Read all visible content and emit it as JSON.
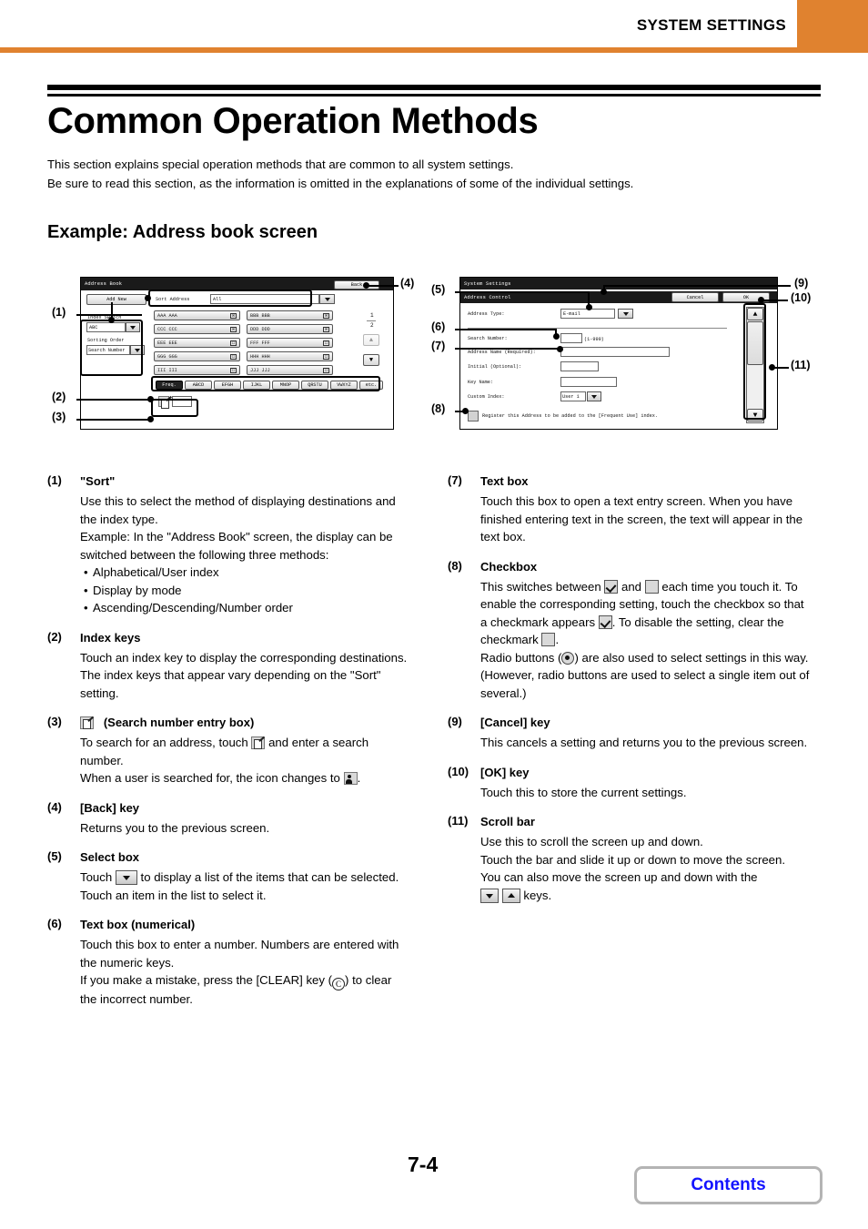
{
  "header": {
    "title": "SYSTEM SETTINGS",
    "accent_color": "#E0822F"
  },
  "chapter": {
    "title": "Common Operation Methods",
    "intro_line1": "This section explains special operation methods that are common to all system settings.",
    "intro_line2": "Be sure to read this section, as the information is omitted in the explanations of some of the individual settings.",
    "section_title": "Example: Address book screen"
  },
  "figure_left": {
    "titlebar": "Address Book",
    "back_key": "Back",
    "add_new_key": "Add New",
    "sort_address_label": "Sort Address",
    "sort_address_value": "All",
    "index_switch_label": "Index Switch",
    "index_switch_value": "ABC",
    "sorting_order_label": "Sorting Order",
    "sorting_order_value": "Search Number",
    "addresses": [
      {
        "name": "AAA AAA",
        "icon": "mail-icon"
      },
      {
        "name": "BBB BBB",
        "icon": "mail-icon"
      },
      {
        "name": "CCC CCC",
        "icon": "mail-icon"
      },
      {
        "name": "DDD DDD",
        "icon": "mail-icon"
      },
      {
        "name": "EEE EEE",
        "icon": "fax-icon"
      },
      {
        "name": "FFF FFF",
        "icon": "fax-icon"
      },
      {
        "name": "GGG GGG",
        "icon": "fax-icon"
      },
      {
        "name": "HHH HHH",
        "icon": "fax-icon"
      },
      {
        "name": "III III",
        "icon": "fax-icon"
      },
      {
        "name": "JJJ JJJ",
        "icon": "fax-icon"
      }
    ],
    "page_current": "1",
    "page_total": "2",
    "index_keys": [
      "Freq.",
      "ABCD",
      "EFGH",
      "IJKL",
      "MNOP",
      "QRSTU",
      "VWXYZ",
      "etc."
    ],
    "search_number_entry_value": "",
    "callouts": [
      "(1)",
      "(2)",
      "(3)",
      "(4)"
    ]
  },
  "figure_right": {
    "titlebar": "System Settings",
    "subtitlebar": "Address Control",
    "cancel_key": "Cancel",
    "ok_key": "OK",
    "fields": [
      {
        "label": "Address Type:",
        "value": "E-mail",
        "kind": "select"
      },
      {
        "label": "Search Number:",
        "value": "",
        "suffix": "(1-999)",
        "kind": "number"
      },
      {
        "label": "Address Name (Required):",
        "value": "",
        "kind": "text"
      },
      {
        "label": "Initial (Optional):",
        "value": "",
        "kind": "text"
      },
      {
        "label": "Key Name:",
        "value": "",
        "kind": "text"
      },
      {
        "label": "Custom Index:",
        "value": "User 1",
        "kind": "select"
      }
    ],
    "checkbox_label": "Register this Address to be added to the [Frequent Use] index.",
    "scrollbar": "scroll-bar",
    "callouts": [
      "(5)",
      "(6)",
      "(7)",
      "(8)",
      "(9)",
      "(10)",
      "(11)"
    ]
  },
  "legend": [
    {
      "num": "(1)",
      "head": "\"Sort\"",
      "body_lines": [
        "Use this to select the method of displaying destinations and the index type.",
        "Example: In the \"Address Book\" screen, the display can be switched between the following three methods:"
      ],
      "bullets": [
        "Alphabetical/User index",
        "Display by mode",
        "Ascending/Descending/Number order"
      ]
    },
    {
      "num": "(2)",
      "head": "Index keys",
      "body_lines": [
        "Touch an index key to display the corresponding destinations. The index keys that appear vary depending on the \"Sort\" setting."
      ]
    },
    {
      "num": "(3)",
      "head": "(Search number entry box)",
      "body_pre": "To search for an address, touch",
      "body_mid": "and enter a search number.",
      "body_post_pre": "When a user is searched for, the icon changes to",
      "body_post_suffix": "."
    },
    {
      "num": "(4)",
      "head": "[Back] key",
      "body_lines": [
        "Returns you to the previous screen."
      ]
    },
    {
      "num": "(5)",
      "head": "Select box",
      "body_pre": "Touch",
      "body_post": "to display a list of the items that can be selected. Touch an item in the list to select it."
    },
    {
      "num": "(6)",
      "head": "Text box (numerical)",
      "body_lines": [
        "Touch this box to enter a number. Numbers are entered with the numeric keys."
      ],
      "body_pre": "If you make a mistake, press the [CLEAR] key (",
      "body_post": ") to clear the incorrect number."
    },
    {
      "num": "(7)",
      "head": "Text box",
      "body_lines": [
        "Touch this box to open a text entry screen. When you have finished entering text in the screen, the text will appear in the text box."
      ]
    },
    {
      "num": "(8)",
      "head": "Checkbox",
      "seg1": "This switches between",
      "seg2": "and",
      "seg3": "each time you touch it. To enable the corresponding setting, touch the checkbox so that a checkmark appears",
      "seg4": ". To disable the setting, clear the checkmark",
      "seg5": ".",
      "seg6": "Radio buttons (",
      "seg7": ") are also used to select settings in this way. (However, radio buttons are used to select a single item out of several.)"
    },
    {
      "num": "(9)",
      "head": "[Cancel] key",
      "body_lines": [
        "This cancels a setting and returns you to the previous screen."
      ]
    },
    {
      "num": "(10)",
      "head": "[OK] key",
      "body_lines": [
        "Touch this to store the current settings."
      ]
    },
    {
      "num": "(11)",
      "head": "Scroll bar",
      "body_lines": [
        "Use this to scroll the screen up and down.",
        "Touch the bar and slide it up or down to move the screen.",
        "You can also move the screen up and down with the"
      ],
      "body_suffix": "keys."
    }
  ],
  "footer": {
    "page_number": "7-4",
    "contents_label": "Contents",
    "contents_color": "#1414ff"
  }
}
